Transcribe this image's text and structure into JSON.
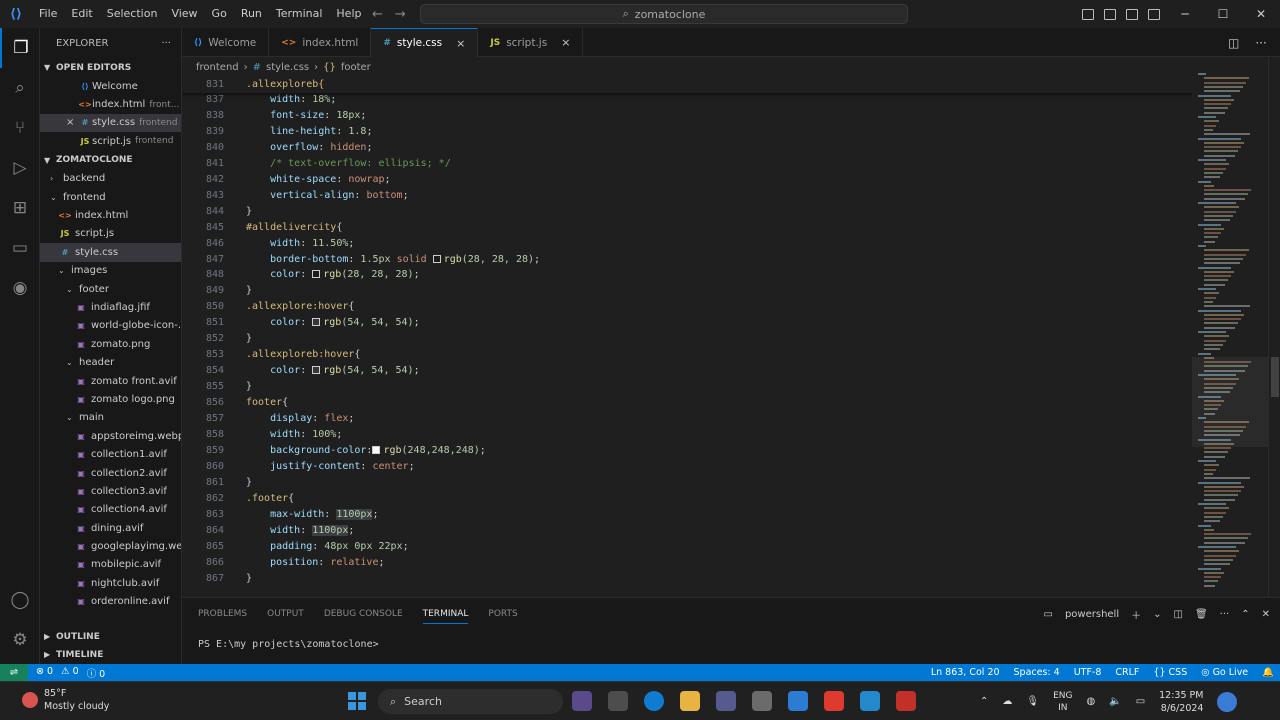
{
  "window": {
    "menu": [
      "File",
      "Edit",
      "Selection",
      "View",
      "Go",
      "Run",
      "Terminal",
      "Help"
    ],
    "search_text": "zomatoclone",
    "search_icon": "search-icon"
  },
  "sidebar": {
    "title": "EXPLORER",
    "more": "···",
    "open_editors_label": "OPEN EDITORS",
    "open_editors": [
      {
        "icon": "vscode-icon",
        "name": "Welcome",
        "path": ""
      },
      {
        "icon": "html-icon",
        "name": "index.html",
        "path": "front..."
      },
      {
        "icon": "css-icon",
        "name": "style.css",
        "path": "frontend",
        "close": "×"
      },
      {
        "icon": "js-icon",
        "name": "script.js",
        "path": "frontend"
      }
    ],
    "project_label": "ZOMATOCLONE",
    "tree": [
      {
        "name": "backend",
        "kind": "folder",
        "open": false,
        "depth": 0
      },
      {
        "name": "frontend",
        "kind": "folder",
        "open": true,
        "depth": 0
      },
      {
        "name": "index.html",
        "kind": "html",
        "depth": 1
      },
      {
        "name": "script.js",
        "kind": "js",
        "depth": 1
      },
      {
        "name": "style.css",
        "kind": "css",
        "depth": 1,
        "selected": true
      },
      {
        "name": "images",
        "kind": "folder",
        "open": true,
        "depth": 1
      },
      {
        "name": "footer",
        "kind": "folder",
        "open": true,
        "depth": 2
      },
      {
        "name": "indiaflag.jfif",
        "kind": "img",
        "depth": 3
      },
      {
        "name": "world-globe-icon-...",
        "kind": "img",
        "depth": 3
      },
      {
        "name": "zomato.png",
        "kind": "img",
        "depth": 3
      },
      {
        "name": "header",
        "kind": "folder",
        "open": true,
        "depth": 2
      },
      {
        "name": "zomato front.avif",
        "kind": "img",
        "depth": 3
      },
      {
        "name": "zomato logo.png",
        "kind": "img",
        "depth": 3
      },
      {
        "name": "main",
        "kind": "folder",
        "open": true,
        "depth": 2
      },
      {
        "name": "appstoreimg.webp",
        "kind": "img",
        "depth": 3
      },
      {
        "name": "collection1.avif",
        "kind": "img",
        "depth": 3
      },
      {
        "name": "collection2.avif",
        "kind": "img",
        "depth": 3
      },
      {
        "name": "collection3.avif",
        "kind": "img",
        "depth": 3
      },
      {
        "name": "collection4.avif",
        "kind": "img",
        "depth": 3
      },
      {
        "name": "dining.avif",
        "kind": "img",
        "depth": 3
      },
      {
        "name": "googleplayimg.we...",
        "kind": "img",
        "depth": 3
      },
      {
        "name": "mobilepic.avif",
        "kind": "img",
        "depth": 3
      },
      {
        "name": "nightclub.avif",
        "kind": "img",
        "depth": 3
      },
      {
        "name": "orderonline.avif",
        "kind": "img",
        "depth": 3
      }
    ],
    "outline_label": "OUTLINE",
    "timeline_label": "TIMELINE"
  },
  "tabs": [
    {
      "name": "Welcome",
      "icon": "vscode-icon",
      "active": false
    },
    {
      "name": "index.html",
      "icon": "html-icon",
      "active": false
    },
    {
      "name": "style.css",
      "icon": "css-icon",
      "active": true,
      "close": "×"
    },
    {
      "name": "script.js",
      "icon": "js-icon",
      "active": false,
      "close": "×"
    }
  ],
  "breadcrumb": [
    "frontend",
    "style.css",
    "footer"
  ],
  "editor": {
    "lines": [
      {
        "n": "837",
        "tokens": [
          [
            "    ",
            "pun"
          ],
          [
            "width",
            "prop"
          ],
          [
            ": ",
            "pun"
          ],
          [
            "18%",
            "num"
          ],
          [
            ";",
            "pun"
          ]
        ]
      },
      {
        "n": "838",
        "tokens": [
          [
            "    ",
            "pun"
          ],
          [
            "font-size",
            "prop"
          ],
          [
            ": ",
            "pun"
          ],
          [
            "18px",
            "num"
          ],
          [
            ";",
            "pun"
          ]
        ]
      },
      {
        "n": "839",
        "tokens": [
          [
            "    ",
            "pun"
          ],
          [
            "line-height",
            "prop"
          ],
          [
            ": ",
            "pun"
          ],
          [
            "1.8",
            "num"
          ],
          [
            ";",
            "pun"
          ]
        ]
      },
      {
        "n": "840",
        "tokens": [
          [
            "    ",
            "pun"
          ],
          [
            "overflow",
            "prop"
          ],
          [
            ": ",
            "pun"
          ],
          [
            "hidden",
            "val"
          ],
          [
            ";",
            "pun"
          ]
        ]
      },
      {
        "n": "841",
        "tokens": [
          [
            "    ",
            "pun"
          ],
          [
            "/* text-overflow: ellipsis; */",
            "com"
          ]
        ]
      },
      {
        "n": "842",
        "tokens": [
          [
            "    ",
            "pun"
          ],
          [
            "white-space",
            "prop"
          ],
          [
            ": ",
            "pun"
          ],
          [
            "nowrap",
            "val"
          ],
          [
            ";",
            "pun"
          ]
        ]
      },
      {
        "n": "843",
        "tokens": [
          [
            "    ",
            "pun"
          ],
          [
            "vertical-align",
            "prop"
          ],
          [
            ": ",
            "pun"
          ],
          [
            "bottom",
            "val"
          ],
          [
            ";",
            "pun"
          ]
        ]
      },
      {
        "n": "844",
        "tokens": [
          [
            "}",
            "pun"
          ]
        ]
      },
      {
        "n": "845",
        "tokens": [
          [
            "#alldelivercity",
            "sel"
          ],
          [
            "{",
            "pun"
          ]
        ]
      },
      {
        "n": "846",
        "tokens": [
          [
            "    ",
            "pun"
          ],
          [
            "width",
            "prop"
          ],
          [
            ": ",
            "pun"
          ],
          [
            "11.50%",
            "num"
          ],
          [
            ";",
            "pun"
          ]
        ]
      },
      {
        "n": "847",
        "tokens": [
          [
            "    ",
            "pun"
          ],
          [
            "border-bottom",
            "prop"
          ],
          [
            ": ",
            "pun"
          ],
          [
            "1.5px",
            "num"
          ],
          [
            " ",
            "pun"
          ],
          [
            "solid",
            "val"
          ],
          [
            " ",
            "pun"
          ],
          [
            "#1c1c1c",
            "swatch"
          ],
          [
            "rgb",
            "fn"
          ],
          [
            "(28, 28, 28)",
            "num"
          ],
          [
            ";",
            "pun"
          ]
        ]
      },
      {
        "n": "848",
        "tokens": [
          [
            "    ",
            "pun"
          ],
          [
            "color",
            "prop"
          ],
          [
            ": ",
            "pun"
          ],
          [
            "#1c1c1c",
            "swatch"
          ],
          [
            "rgb",
            "fn"
          ],
          [
            "(28, 28, 28)",
            "num"
          ],
          [
            ";",
            "pun"
          ]
        ]
      },
      {
        "n": "849",
        "tokens": [
          [
            "}",
            "pun"
          ]
        ]
      },
      {
        "n": "850",
        "tokens": [
          [
            ".allexplore:hover",
            "sel"
          ],
          [
            "{",
            "pun"
          ]
        ]
      },
      {
        "n": "851",
        "tokens": [
          [
            "    ",
            "pun"
          ],
          [
            "color",
            "prop"
          ],
          [
            ": ",
            "pun"
          ],
          [
            "#363636",
            "swatch"
          ],
          [
            "rgb",
            "fn"
          ],
          [
            "(54, 54, 54)",
            "num"
          ],
          [
            ";",
            "pun"
          ]
        ]
      },
      {
        "n": "852",
        "tokens": [
          [
            "}",
            "pun"
          ]
        ]
      },
      {
        "n": "853",
        "tokens": [
          [
            ".allexploreb:hover",
            "sel"
          ],
          [
            "{",
            "pun"
          ]
        ]
      },
      {
        "n": "854",
        "tokens": [
          [
            "    ",
            "pun"
          ],
          [
            "color",
            "prop"
          ],
          [
            ": ",
            "pun"
          ],
          [
            "#363636",
            "swatch"
          ],
          [
            "rgb",
            "fn"
          ],
          [
            "(54, 54, 54)",
            "num"
          ],
          [
            ";",
            "pun"
          ]
        ]
      },
      {
        "n": "855",
        "tokens": [
          [
            "}",
            "pun"
          ]
        ]
      },
      {
        "n": "856",
        "tokens": [
          [
            "footer",
            "sel"
          ],
          [
            "{",
            "pun"
          ]
        ]
      },
      {
        "n": "857",
        "tokens": [
          [
            "    ",
            "pun"
          ],
          [
            "display",
            "prop"
          ],
          [
            ": ",
            "pun"
          ],
          [
            "flex",
            "val"
          ],
          [
            ";",
            "pun"
          ]
        ]
      },
      {
        "n": "858",
        "tokens": [
          [
            "    ",
            "pun"
          ],
          [
            "width",
            "prop"
          ],
          [
            ": ",
            "pun"
          ],
          [
            "100%",
            "num"
          ],
          [
            ";",
            "pun"
          ]
        ]
      },
      {
        "n": "859",
        "tokens": [
          [
            "    ",
            "pun"
          ],
          [
            "background-color",
            "prop"
          ],
          [
            ":",
            "pun"
          ],
          [
            "#f8f8f8",
            "swatch"
          ],
          [
            "rgb",
            "fn"
          ],
          [
            "(248,248,248)",
            "num"
          ],
          [
            ";",
            "pun"
          ]
        ]
      },
      {
        "n": "860",
        "tokens": [
          [
            "    ",
            "pun"
          ],
          [
            "justify-content",
            "prop"
          ],
          [
            ": ",
            "pun"
          ],
          [
            "center",
            "val"
          ],
          [
            ";",
            "pun"
          ]
        ]
      },
      {
        "n": "861",
        "tokens": [
          [
            "}",
            "pun"
          ]
        ]
      },
      {
        "n": "862",
        "tokens": [
          [
            ".footer",
            "sel"
          ],
          [
            "{",
            "pun"
          ]
        ]
      },
      {
        "n": "863",
        "tokens": [
          [
            "    ",
            "pun"
          ],
          [
            "max-width",
            "prop"
          ],
          [
            ": ",
            "pun"
          ],
          [
            "1100px",
            "num hl"
          ],
          [
            ";",
            "pun"
          ]
        ]
      },
      {
        "n": "864",
        "tokens": [
          [
            "    ",
            "pun"
          ],
          [
            "width",
            "prop"
          ],
          [
            ": ",
            "pun"
          ],
          [
            "1100px",
            "num hl"
          ],
          [
            ";",
            "pun"
          ]
        ]
      },
      {
        "n": "865",
        "tokens": [
          [
            "    ",
            "pun"
          ],
          [
            "padding",
            "prop"
          ],
          [
            ": ",
            "pun"
          ],
          [
            "48px 0px 22px",
            "num"
          ],
          [
            ";",
            "pun"
          ]
        ]
      },
      {
        "n": "866",
        "tokens": [
          [
            "    ",
            "pun"
          ],
          [
            "position",
            "prop"
          ],
          [
            ": ",
            "pun"
          ],
          [
            "relative",
            "val"
          ],
          [
            ";",
            "pun"
          ]
        ]
      },
      {
        "n": "867",
        "tokens": [
          [
            "}",
            "pun"
          ]
        ]
      }
    ],
    "sticky": {
      "n": "831",
      "text": ".allexploreb{"
    }
  },
  "panel": {
    "tabs": [
      "PROBLEMS",
      "OUTPUT",
      "DEBUG CONSOLE",
      "TERMINAL",
      "PORTS"
    ],
    "active_tab": "TERMINAL",
    "shell": "powershell",
    "prompt": "PS E:\\my projects\\zomatoclone> "
  },
  "status": {
    "errors": "0",
    "warnings": "0",
    "info": "0",
    "position": "Ln 863, Col 20",
    "spaces": "Spaces: 4",
    "encoding": "UTF-8",
    "eol": "CRLF",
    "language": "CSS",
    "golive": "Go Live"
  },
  "taskbar": {
    "temp": "85°F",
    "weather": "Mostly cloudy",
    "search": "Search",
    "lang1": "ENG",
    "lang2": "IN",
    "time": "12:35 PM",
    "date": "8/6/2024"
  },
  "colors": {
    "accent": "#0078d4",
    "statusbar": "#0078d4",
    "remote": "#16825d"
  }
}
